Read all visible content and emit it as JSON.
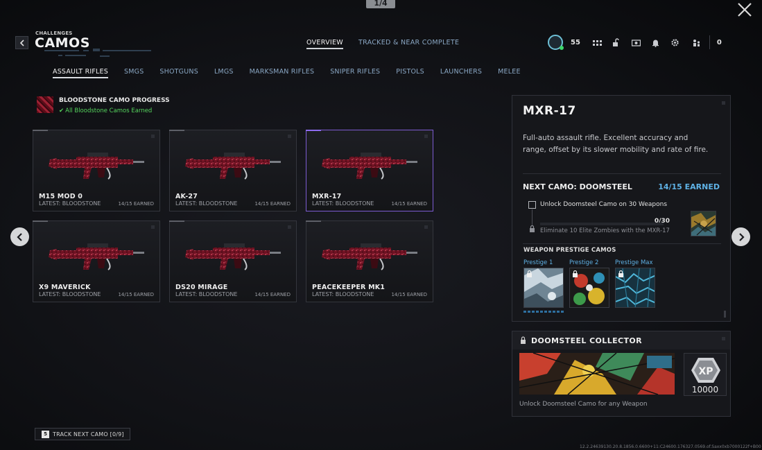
{
  "page_counter": "1/4",
  "header": {
    "crumb": "CHALLENGES",
    "title": "CAMOS",
    "tabs": [
      {
        "label": "OVERVIEW",
        "active": true
      },
      {
        "label": "TRACKED & NEAR COMPLETE",
        "active": false
      }
    ],
    "level": "55",
    "cod_points": "0",
    "icons": [
      "level-badge-icon",
      "grid-icon",
      "store-icon",
      "camera-icon",
      "bell-icon",
      "gear-icon",
      "party-icon"
    ]
  },
  "categories": [
    {
      "label": "ASSAULT RIFLES",
      "active": true
    },
    {
      "label": "SMGS",
      "active": false
    },
    {
      "label": "SHOTGUNS",
      "active": false
    },
    {
      "label": "LMGS",
      "active": false
    },
    {
      "label": "MARKSMAN RIFLES",
      "active": false
    },
    {
      "label": "SNIPER RIFLES",
      "active": false
    },
    {
      "label": "PISTOLS",
      "active": false
    },
    {
      "label": "LAUNCHERS",
      "active": false
    },
    {
      "label": "MELEE",
      "active": false
    }
  ],
  "progress": {
    "title": "BLOODSTONE CAMO PROGRESS",
    "status": "All Bloodstone Camos Earned"
  },
  "weapons": [
    {
      "name": "M15 MOD 0",
      "latest": "LATEST: BLOODSTONE",
      "earned": "14/15 EARNED",
      "selected": false
    },
    {
      "name": "AK-27",
      "latest": "LATEST: BLOODSTONE",
      "earned": "14/15 EARNED",
      "selected": false
    },
    {
      "name": "MXR-17",
      "latest": "LATEST: BLOODSTONE",
      "earned": "14/15 EARNED",
      "selected": true
    },
    {
      "name": "X9 MAVERICK",
      "latest": "LATEST: BLOODSTONE",
      "earned": "14/15 EARNED",
      "selected": false
    },
    {
      "name": "DS20 MIRAGE",
      "latest": "LATEST: BLOODSTONE",
      "earned": "14/15 EARNED",
      "selected": false
    },
    {
      "name": "PEACEKEEPER MK1",
      "latest": "LATEST: BLOODSTONE",
      "earned": "14/15 EARNED",
      "selected": false
    }
  ],
  "detail": {
    "name": "MXR-17",
    "description": "Full-auto assault rifle. Excellent accuracy and range, offset by its slower mobility and rate of fire.",
    "next_camo": "NEXT CAMO: DOOMSTEEL",
    "next_earned": "14/15 EARNED",
    "challenge": "Unlock Doomsteel Camo on 30 Weapons",
    "challenge_progress": "0/30",
    "challenge_fraction": 0,
    "challenge_sub": "Eliminate 10 Elite Zombies with the MXR-17",
    "prestige_heading": "WEAPON PRESTIGE CAMOS",
    "prestige": [
      {
        "label": "Prestige 1"
      },
      {
        "label": "Prestige 2"
      },
      {
        "label": "Prestige Max"
      }
    ]
  },
  "collector": {
    "title": "DOOMSTEEL COLLECTOR",
    "xp": "10000",
    "description": "Unlock Doomsteel Camo for any Weapon"
  },
  "track_button": {
    "key": "5",
    "label": "TRACK NEXT CAMO [0/9]"
  },
  "build_string": "12.2.24639130.20.8.1856.0.6600+11:C24600.176327.0569.of.Saxx0xb7000122f+B00",
  "colors": {
    "accent_blue": "#5fb2e6",
    "selected_purple": "#8e6bf0",
    "success_green": "#56d65e",
    "camo_red": "#9d2133"
  }
}
